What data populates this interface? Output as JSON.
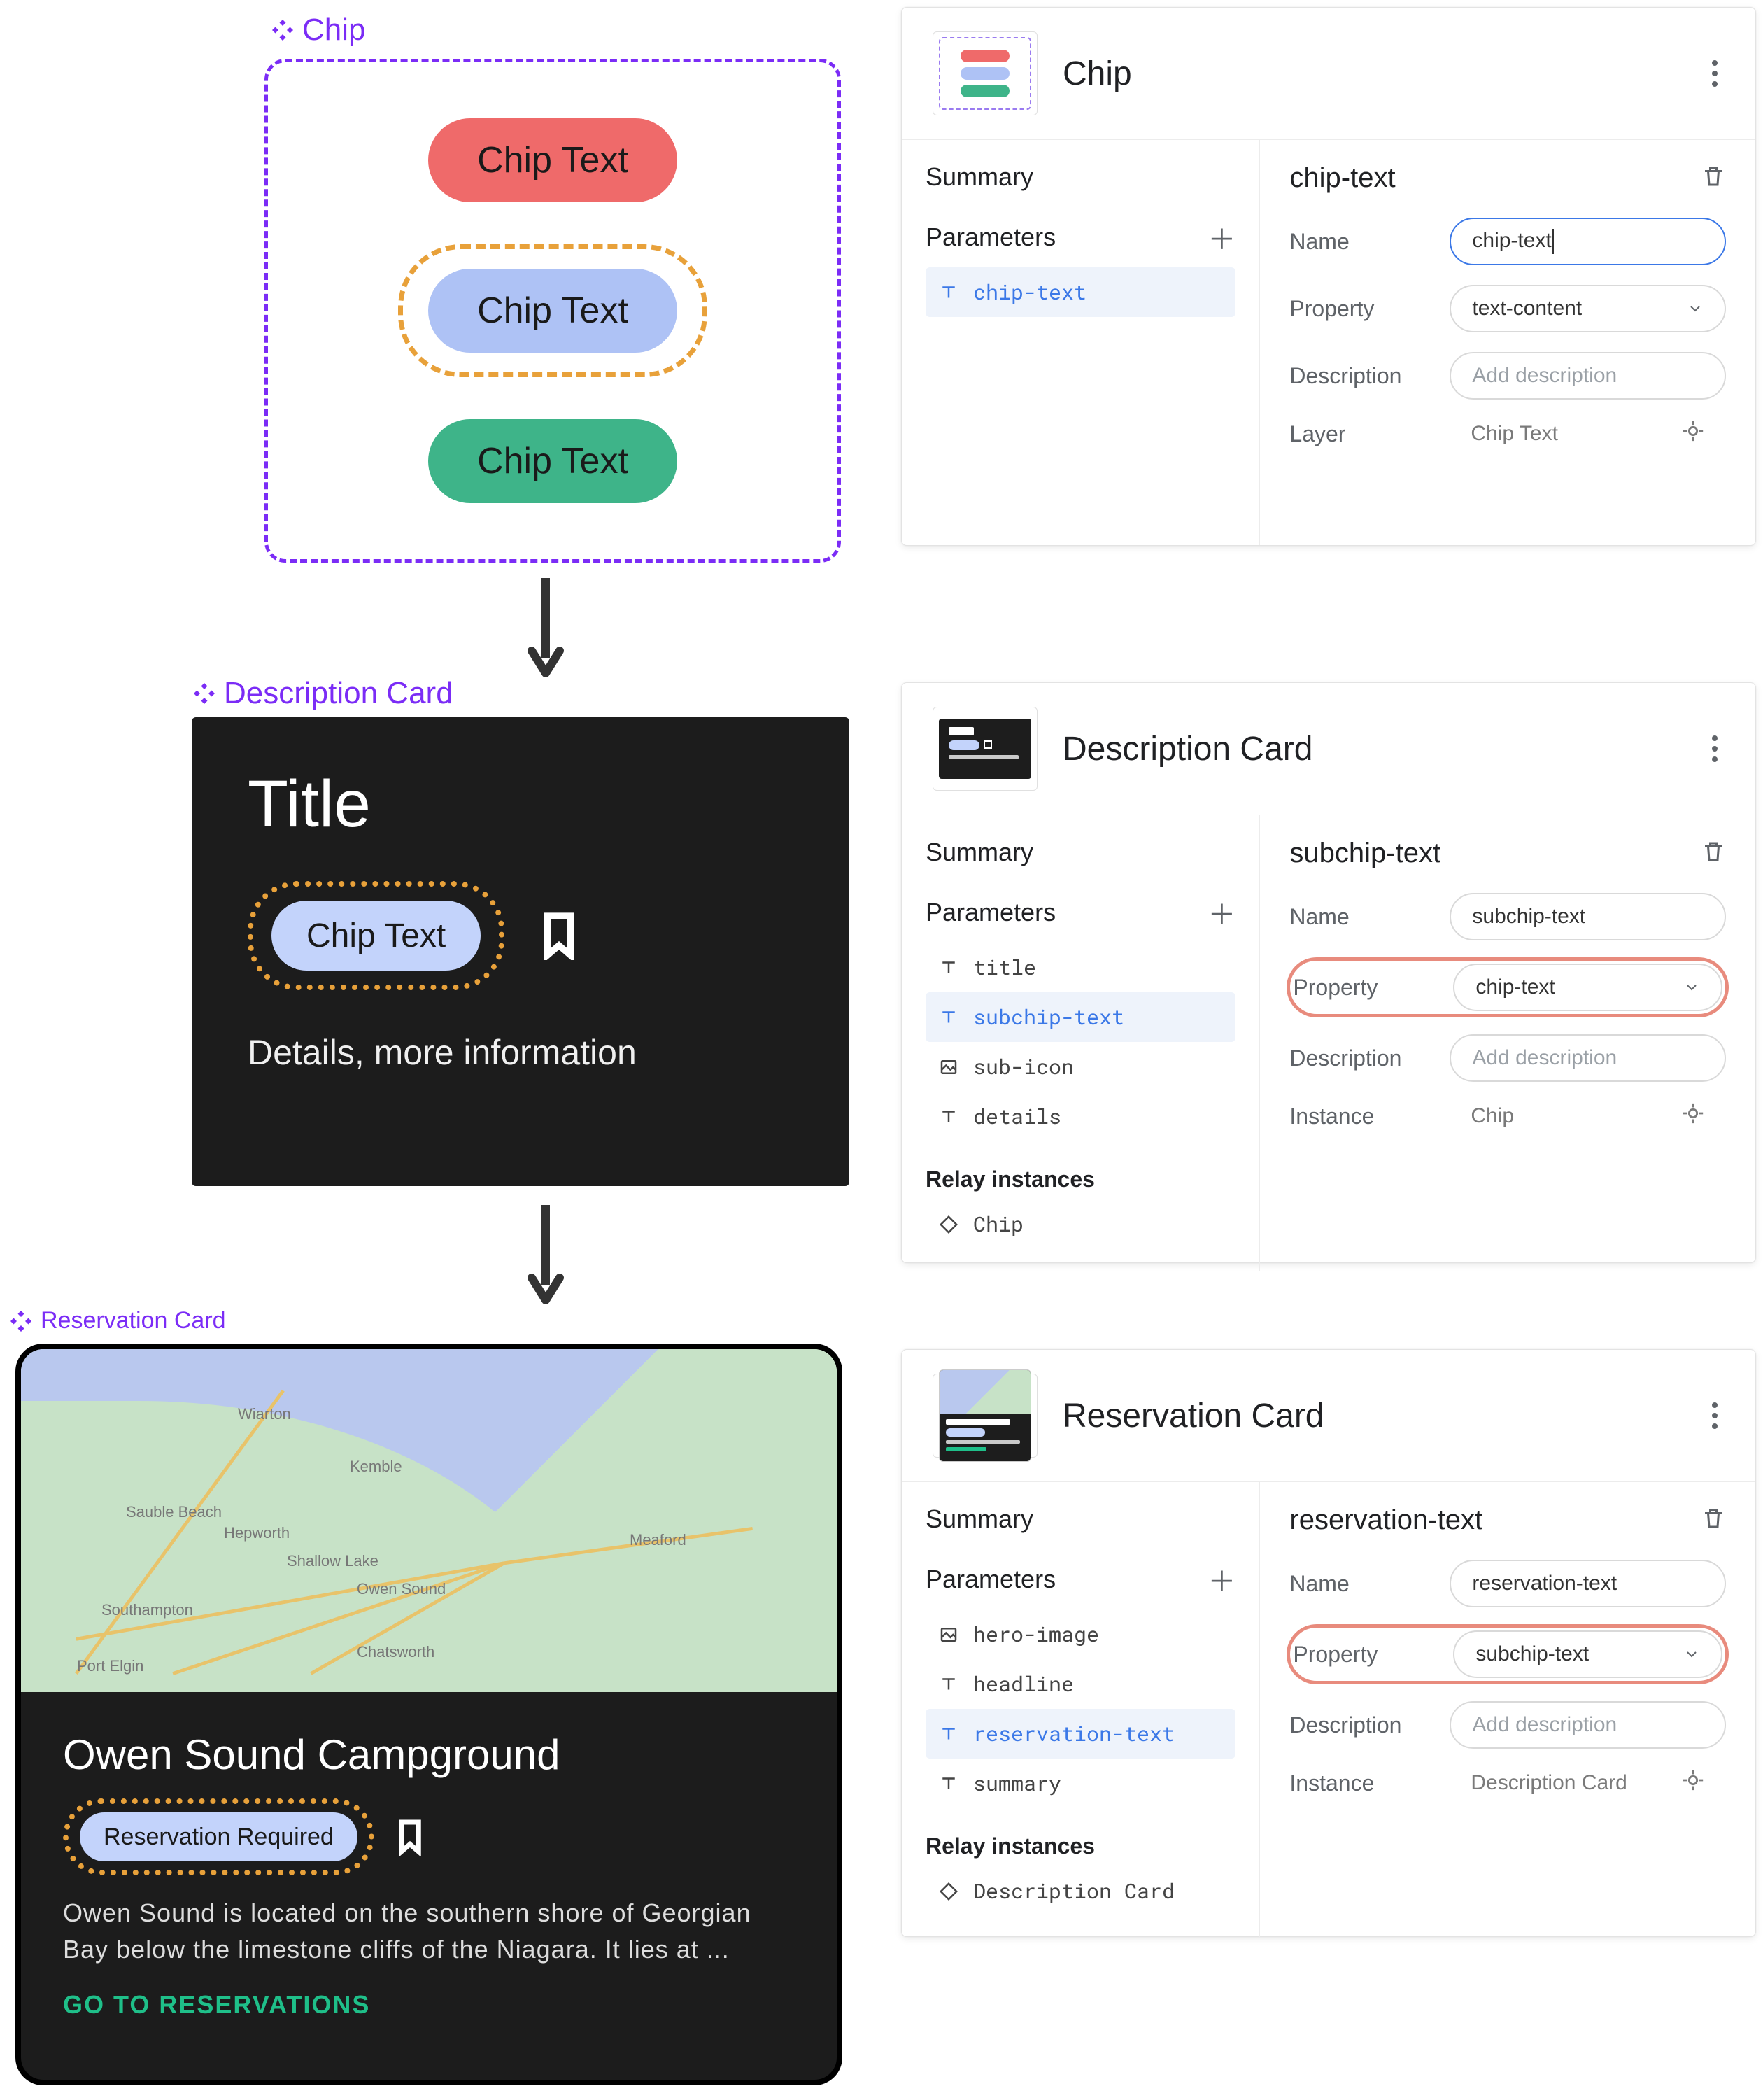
{
  "components": {
    "chip": {
      "label": "Chip",
      "chips": [
        "Chip Text",
        "Chip Text",
        "Chip Text"
      ]
    },
    "description_card": {
      "label": "Description Card",
      "title": "Title",
      "chip_text": "Chip Text",
      "details": "Details, more information"
    },
    "reservation_card": {
      "label": "Reservation Card",
      "map_places": [
        "Wiarton",
        "Kemble",
        "Sauble Beach",
        "Hepworth",
        "Shallow Lake",
        "Owen Sound",
        "Meaford",
        "Southampton",
        "Chatsworth",
        "Port Elgin"
      ],
      "headline": "Owen Sound Campground",
      "chip_text": "Reservation Required",
      "summary": "Owen Sound is located on the southern shore of Georgian Bay below the limestone cliffs of the Niagara. It lies at ...",
      "cta": "GO TO RESERVATIONS"
    }
  },
  "panels": {
    "chip": {
      "title": "Chip",
      "summary": "Summary",
      "parameters_label": "Parameters",
      "parameters": [
        {
          "icon": "text",
          "name": "chip-text",
          "selected": true
        }
      ],
      "right": {
        "heading": "chip-text",
        "fields": {
          "name_label": "Name",
          "name_value": "chip-text",
          "property_label": "Property",
          "property_value": "text-content",
          "description_label": "Description",
          "description_placeholder": "Add description",
          "layer_label": "Layer",
          "layer_value": "Chip Text"
        }
      }
    },
    "description_card": {
      "title": "Description Card",
      "summary": "Summary",
      "parameters_label": "Parameters",
      "parameters": [
        {
          "icon": "text",
          "name": "title"
        },
        {
          "icon": "text",
          "name": "subchip-text",
          "selected": true
        },
        {
          "icon": "image",
          "name": "sub-icon"
        },
        {
          "icon": "text",
          "name": "details"
        }
      ],
      "relay_label": "Relay instances",
      "relay_instances": [
        {
          "icon": "diamond",
          "name": "Chip"
        }
      ],
      "right": {
        "heading": "subchip-text",
        "fields": {
          "name_label": "Name",
          "name_value": "subchip-text",
          "property_label": "Property",
          "property_value": "chip-text",
          "description_label": "Description",
          "description_placeholder": "Add description",
          "instance_label": "Instance",
          "instance_value": "Chip"
        }
      }
    },
    "reservation_card": {
      "title": "Reservation Card",
      "summary": "Summary",
      "parameters_label": "Parameters",
      "parameters": [
        {
          "icon": "image",
          "name": "hero-image"
        },
        {
          "icon": "text",
          "name": "headline"
        },
        {
          "icon": "text",
          "name": "reservation-text",
          "selected": true
        },
        {
          "icon": "text",
          "name": "summary"
        }
      ],
      "relay_label": "Relay instances",
      "relay_instances": [
        {
          "icon": "diamond",
          "name": "Description Card"
        }
      ],
      "right": {
        "heading": "reservation-text",
        "fields": {
          "name_label": "Name",
          "name_value": "reservation-text",
          "property_label": "Property",
          "property_value": "subchip-text",
          "description_label": "Description",
          "description_placeholder": "Add description",
          "instance_label": "Instance",
          "instance_value": "Description Card"
        }
      }
    }
  }
}
